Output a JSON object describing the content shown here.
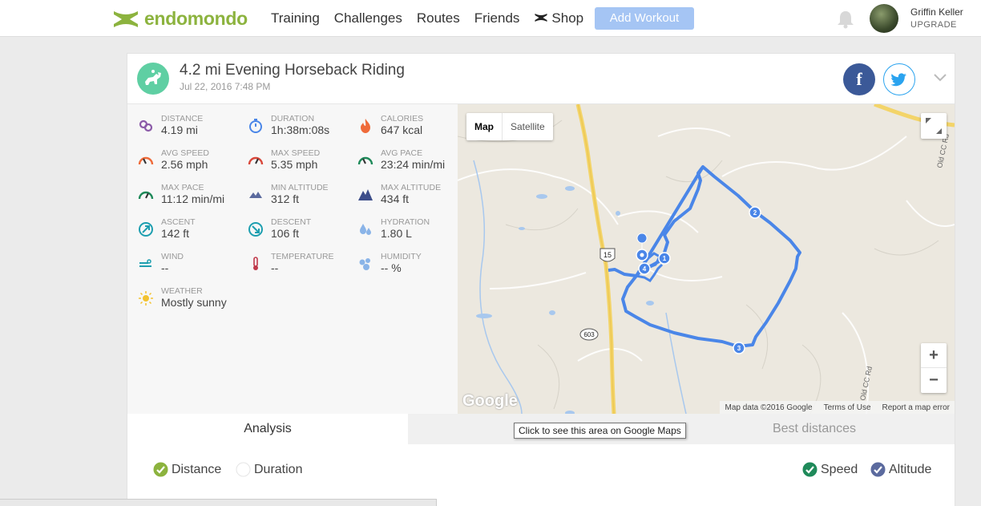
{
  "nav": {
    "logo": "endomondo",
    "links": [
      "Training",
      "Challenges",
      "Routes",
      "Friends"
    ],
    "shop": "Shop",
    "add_workout": "Add Workout",
    "user_name": "Griffin Keller",
    "upgrade": "UPGRADE"
  },
  "workout": {
    "title": "4.2 mi Evening Horseback Riding",
    "date": "Jul 22, 2016 7:48 PM",
    "facebook": "f"
  },
  "stats": [
    {
      "label": "DISTANCE",
      "value": "4.19 mi",
      "icon": "pin-icon"
    },
    {
      "label": "DURATION",
      "value": "1h:38m:08s",
      "icon": "stopwatch-icon"
    },
    {
      "label": "CALORIES",
      "value": "647 kcal",
      "icon": "flame-icon"
    },
    {
      "label": "AVG SPEED",
      "value": "2.56 mph",
      "icon": "speedometer-icon"
    },
    {
      "label": "MAX SPEED",
      "value": "5.35 mph",
      "icon": "speedometer-icon"
    },
    {
      "label": "AVG PACE",
      "value": "23:24 min/mi",
      "icon": "pace-gauge-icon"
    },
    {
      "label": "MAX PACE",
      "value": "11:12 min/mi",
      "icon": "pace-gauge-icon"
    },
    {
      "label": "MIN ALTITUDE",
      "value": "312 ft",
      "icon": "mountain-icon"
    },
    {
      "label": "MAX ALTITUDE",
      "value": "434 ft",
      "icon": "mountain-icon"
    },
    {
      "label": "ASCENT",
      "value": "142 ft",
      "icon": "ascent-icon"
    },
    {
      "label": "DESCENT",
      "value": "106 ft",
      "icon": "descent-icon"
    },
    {
      "label": "HYDRATION",
      "value": "1.80 L",
      "icon": "water-drops-icon"
    },
    {
      "label": "WIND",
      "value": "--",
      "icon": "wind-icon"
    },
    {
      "label": "TEMPERATURE",
      "value": "--",
      "icon": "thermometer-icon"
    },
    {
      "label": "HUMIDITY",
      "value": "-- %",
      "icon": "humidity-icon"
    },
    {
      "label": "WEATHER",
      "value": "Mostly sunny",
      "icon": "sun-icon"
    }
  ],
  "map": {
    "type_map": "Map",
    "type_satellite": "Satellite",
    "zoom_in": "+",
    "zoom_out": "−",
    "google": "Google",
    "attribution": "Map data ©2016 Google",
    "terms": "Terms of Use",
    "report": "Report a map error",
    "route_color": "#4a86e8",
    "road_labels": {
      "hwy15": "15",
      "hwy603": "603",
      "old_cc_rd": "Old CC Rd"
    },
    "markers": [
      "1",
      "2",
      "3",
      "4"
    ],
    "tooltip": "Click to see this area on Google Maps"
  },
  "tabs": {
    "analysis": "Analysis",
    "best": "Best distances"
  },
  "options": {
    "distance": "Distance",
    "duration": "Duration",
    "speed": "Speed",
    "altitude": "Altitude"
  },
  "colors": {
    "brand_green": "#8cb33e",
    "add_workout": "#a5c5f4",
    "sport_icon": "#5fcfa3",
    "facebook": "#3b5998",
    "twitter": "#2aa3ef"
  }
}
